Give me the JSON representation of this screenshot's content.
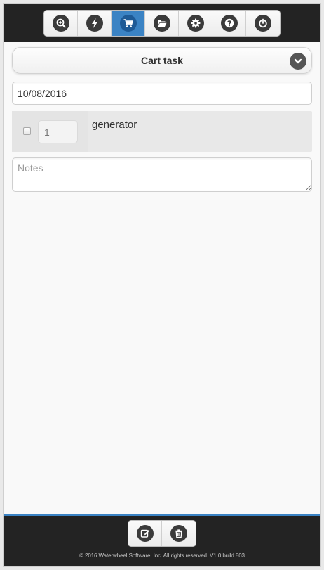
{
  "navbar": {
    "buttons": [
      {
        "icon": "search-plus-icon",
        "active": false
      },
      {
        "icon": "lightning-icon",
        "active": false
      },
      {
        "icon": "cart-icon",
        "active": true
      },
      {
        "icon": "folder-open-icon",
        "active": false
      },
      {
        "icon": "gear-icon",
        "active": false
      },
      {
        "icon": "question-icon",
        "active": false
      },
      {
        "icon": "power-icon",
        "active": false
      }
    ],
    "active_color": "#3b83c4"
  },
  "task": {
    "title": "Cart task",
    "toggle_icon": "chevron-down-icon",
    "date": "10/08/2016",
    "items": [
      {
        "checked": false,
        "quantity": "1",
        "name": "generator"
      }
    ],
    "notes_placeholder": "Notes",
    "notes_value": ""
  },
  "footer": {
    "buttons": [
      {
        "icon": "edit-icon"
      },
      {
        "icon": "trash-icon"
      }
    ],
    "copyright": "© 2016 Waterwheel Software, Inc. All rights reserved. V1.0 build 803"
  }
}
